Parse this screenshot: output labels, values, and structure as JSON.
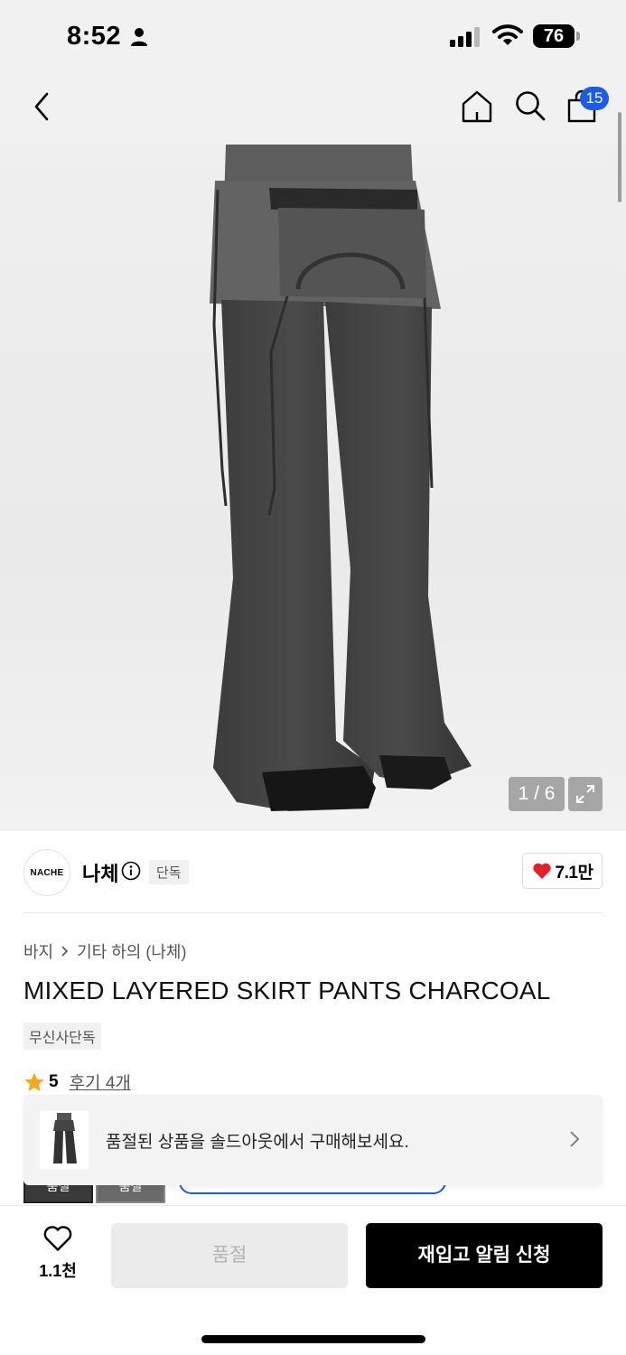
{
  "status_bar": {
    "time": "8:52",
    "battery": "76"
  },
  "nav": {
    "cart_count": "15"
  },
  "gallery": {
    "pager": "1 / 6"
  },
  "brand": {
    "logo_text": "NACHE",
    "name": "나체",
    "tag": "단독",
    "likes": "7.1만"
  },
  "breadcrumb": {
    "level1": "바지",
    "level2": "기타 하의 (나체)"
  },
  "product": {
    "title": "MIXED LAYERED SKIRT PANTS CHARCOAL",
    "exclusive_tag": "무신사단독",
    "rating": "5",
    "reviews": "후기 4개"
  },
  "under_thumbs": [
    "품절",
    "품절"
  ],
  "toast": {
    "message": "품절된 상품을 솔드아웃에서 구매해보세요."
  },
  "bottom_bar": {
    "wish_count": "1.1천",
    "soldout_label": "품절",
    "restock_label": "재입고 알림 신청"
  },
  "colors": {
    "accent_blue": "#1a5be8",
    "heart_red": "#e5202c",
    "star_orange": "#f5a623"
  }
}
